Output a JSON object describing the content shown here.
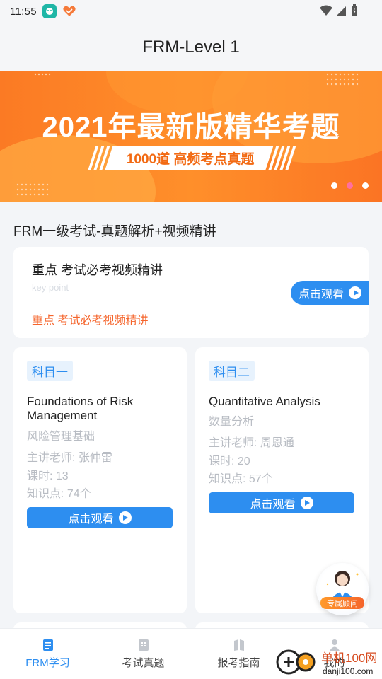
{
  "status_bar": {
    "time": "11:55"
  },
  "header": {
    "title": "FRM-Level 1"
  },
  "banner": {
    "title": "2021年最新版精华考题",
    "subtitle": "1000道 高频考点真题",
    "dots": [
      {
        "color": "#ffffff"
      },
      {
        "color": "#ff6fa0"
      },
      {
        "color": "#ffffff"
      }
    ]
  },
  "section": {
    "title": "FRM一级考试-真题解析+视频精讲"
  },
  "key_card": {
    "title": "重点 考试必考视频精讲",
    "subtitle": "key point",
    "highlight": "重点 考试必考视频精讲",
    "button": "点击观看"
  },
  "subjects": [
    {
      "tag": "科目一",
      "name_en": "Foundations of Risk Management",
      "name_cn": "风险管理基础",
      "teacher": "主讲老师: 张仲雷",
      "hours": "课时: 13",
      "points": "知识点: 74个",
      "button": "点击观看"
    },
    {
      "tag": "科目二",
      "name_en": "Quantitative Analysis",
      "name_cn": "数量分析",
      "teacher": "主讲老师: 周恩通",
      "hours": "课时: 20",
      "points": "知识点: 57个",
      "button": "点击观看"
    }
  ],
  "advisor": {
    "label": "专属顾问"
  },
  "bottom_nav": [
    {
      "label": "FRM学习",
      "icon": "book-icon",
      "active": true
    },
    {
      "label": "考试真题",
      "icon": "exam-icon",
      "active": false
    },
    {
      "label": "报考指南",
      "icon": "guide-icon",
      "active": false
    },
    {
      "label": "我的",
      "icon": "profile-icon",
      "active": false
    }
  ],
  "watermark": {
    "brand": "单机100网",
    "url": "danji100.com"
  },
  "colors": {
    "accent": "#2d8ef0",
    "banner": "#fb7a24",
    "highlight": "#f5642b"
  }
}
